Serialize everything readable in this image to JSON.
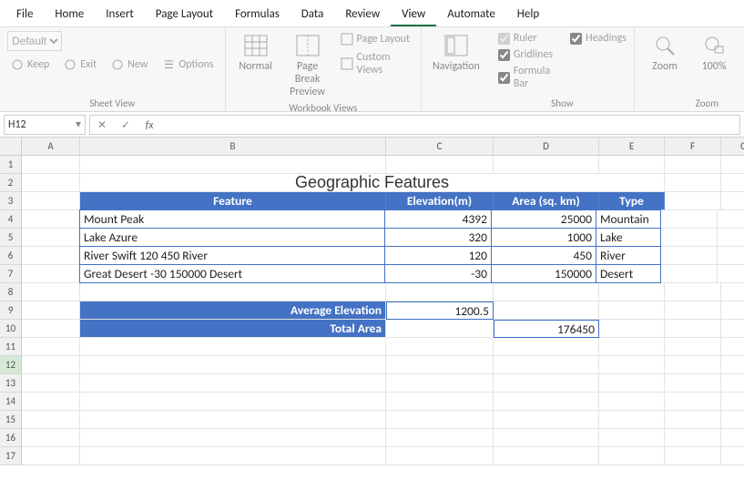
{
  "menu": {
    "items": [
      "File",
      "Home",
      "Insert",
      "Page Layout",
      "Formulas",
      "Data",
      "Review",
      "View",
      "Automate",
      "Help"
    ],
    "active": "View"
  },
  "ribbon": {
    "sheetview": {
      "default": "Default",
      "keep": "Keep",
      "exit": "Exit",
      "new": "New",
      "options": "Options",
      "label": "Sheet View"
    },
    "workbook": {
      "normal": "Normal",
      "pagebreak": "Page Break\nPreview",
      "pagelayout": "Page Layout",
      "custom": "Custom Views",
      "label": "Workbook Views"
    },
    "navigation": {
      "btn": "Navigation"
    },
    "show": {
      "ruler": "Ruler",
      "gridlines": "Gridlines",
      "formulabar": "Formula Bar",
      "headings": "Headings",
      "label": "Show"
    },
    "zoom": {
      "zoom": "Zoom",
      "hundred": "100%",
      "label": "Zoom"
    }
  },
  "formula_bar": {
    "namebox": "H12",
    "cancel": "✕",
    "enter": "✓",
    "fx": "fx",
    "value": "",
    "placeholder": ""
  },
  "grid": {
    "columns": [
      "A",
      "B",
      "C",
      "D",
      "E",
      "F",
      "G"
    ],
    "rows": [
      "1",
      "2",
      "3",
      "4",
      "5",
      "6",
      "7",
      "8",
      "9",
      "10",
      "11",
      "12",
      "13",
      "14",
      "15",
      "16",
      "17"
    ],
    "selected_row": "12"
  },
  "sheet": {
    "title": "Geographic Features",
    "headers": {
      "feature": "Feature",
      "elevation": "Elevation(m)",
      "area": "Area (sq. km)",
      "type": "Type"
    },
    "rows": [
      {
        "feature": "Mount Peak",
        "elevation": "4392",
        "area": "25000",
        "type": "Mountain"
      },
      {
        "feature": "Lake Azure",
        "elevation": "320",
        "area": "1000",
        "type": "Lake"
      },
      {
        "feature": "River Swift 120 450 River",
        "elevation": "120",
        "area": "450",
        "type": "River"
      },
      {
        "feature": "Great Desert -30 150000 Desert",
        "elevation": "-30",
        "area": "150000",
        "type": "Desert"
      }
    ],
    "summary": {
      "avg_label": "Average Elevation",
      "avg_value": "1200.5",
      "total_label": "Total Area",
      "total_value": "176450"
    }
  }
}
